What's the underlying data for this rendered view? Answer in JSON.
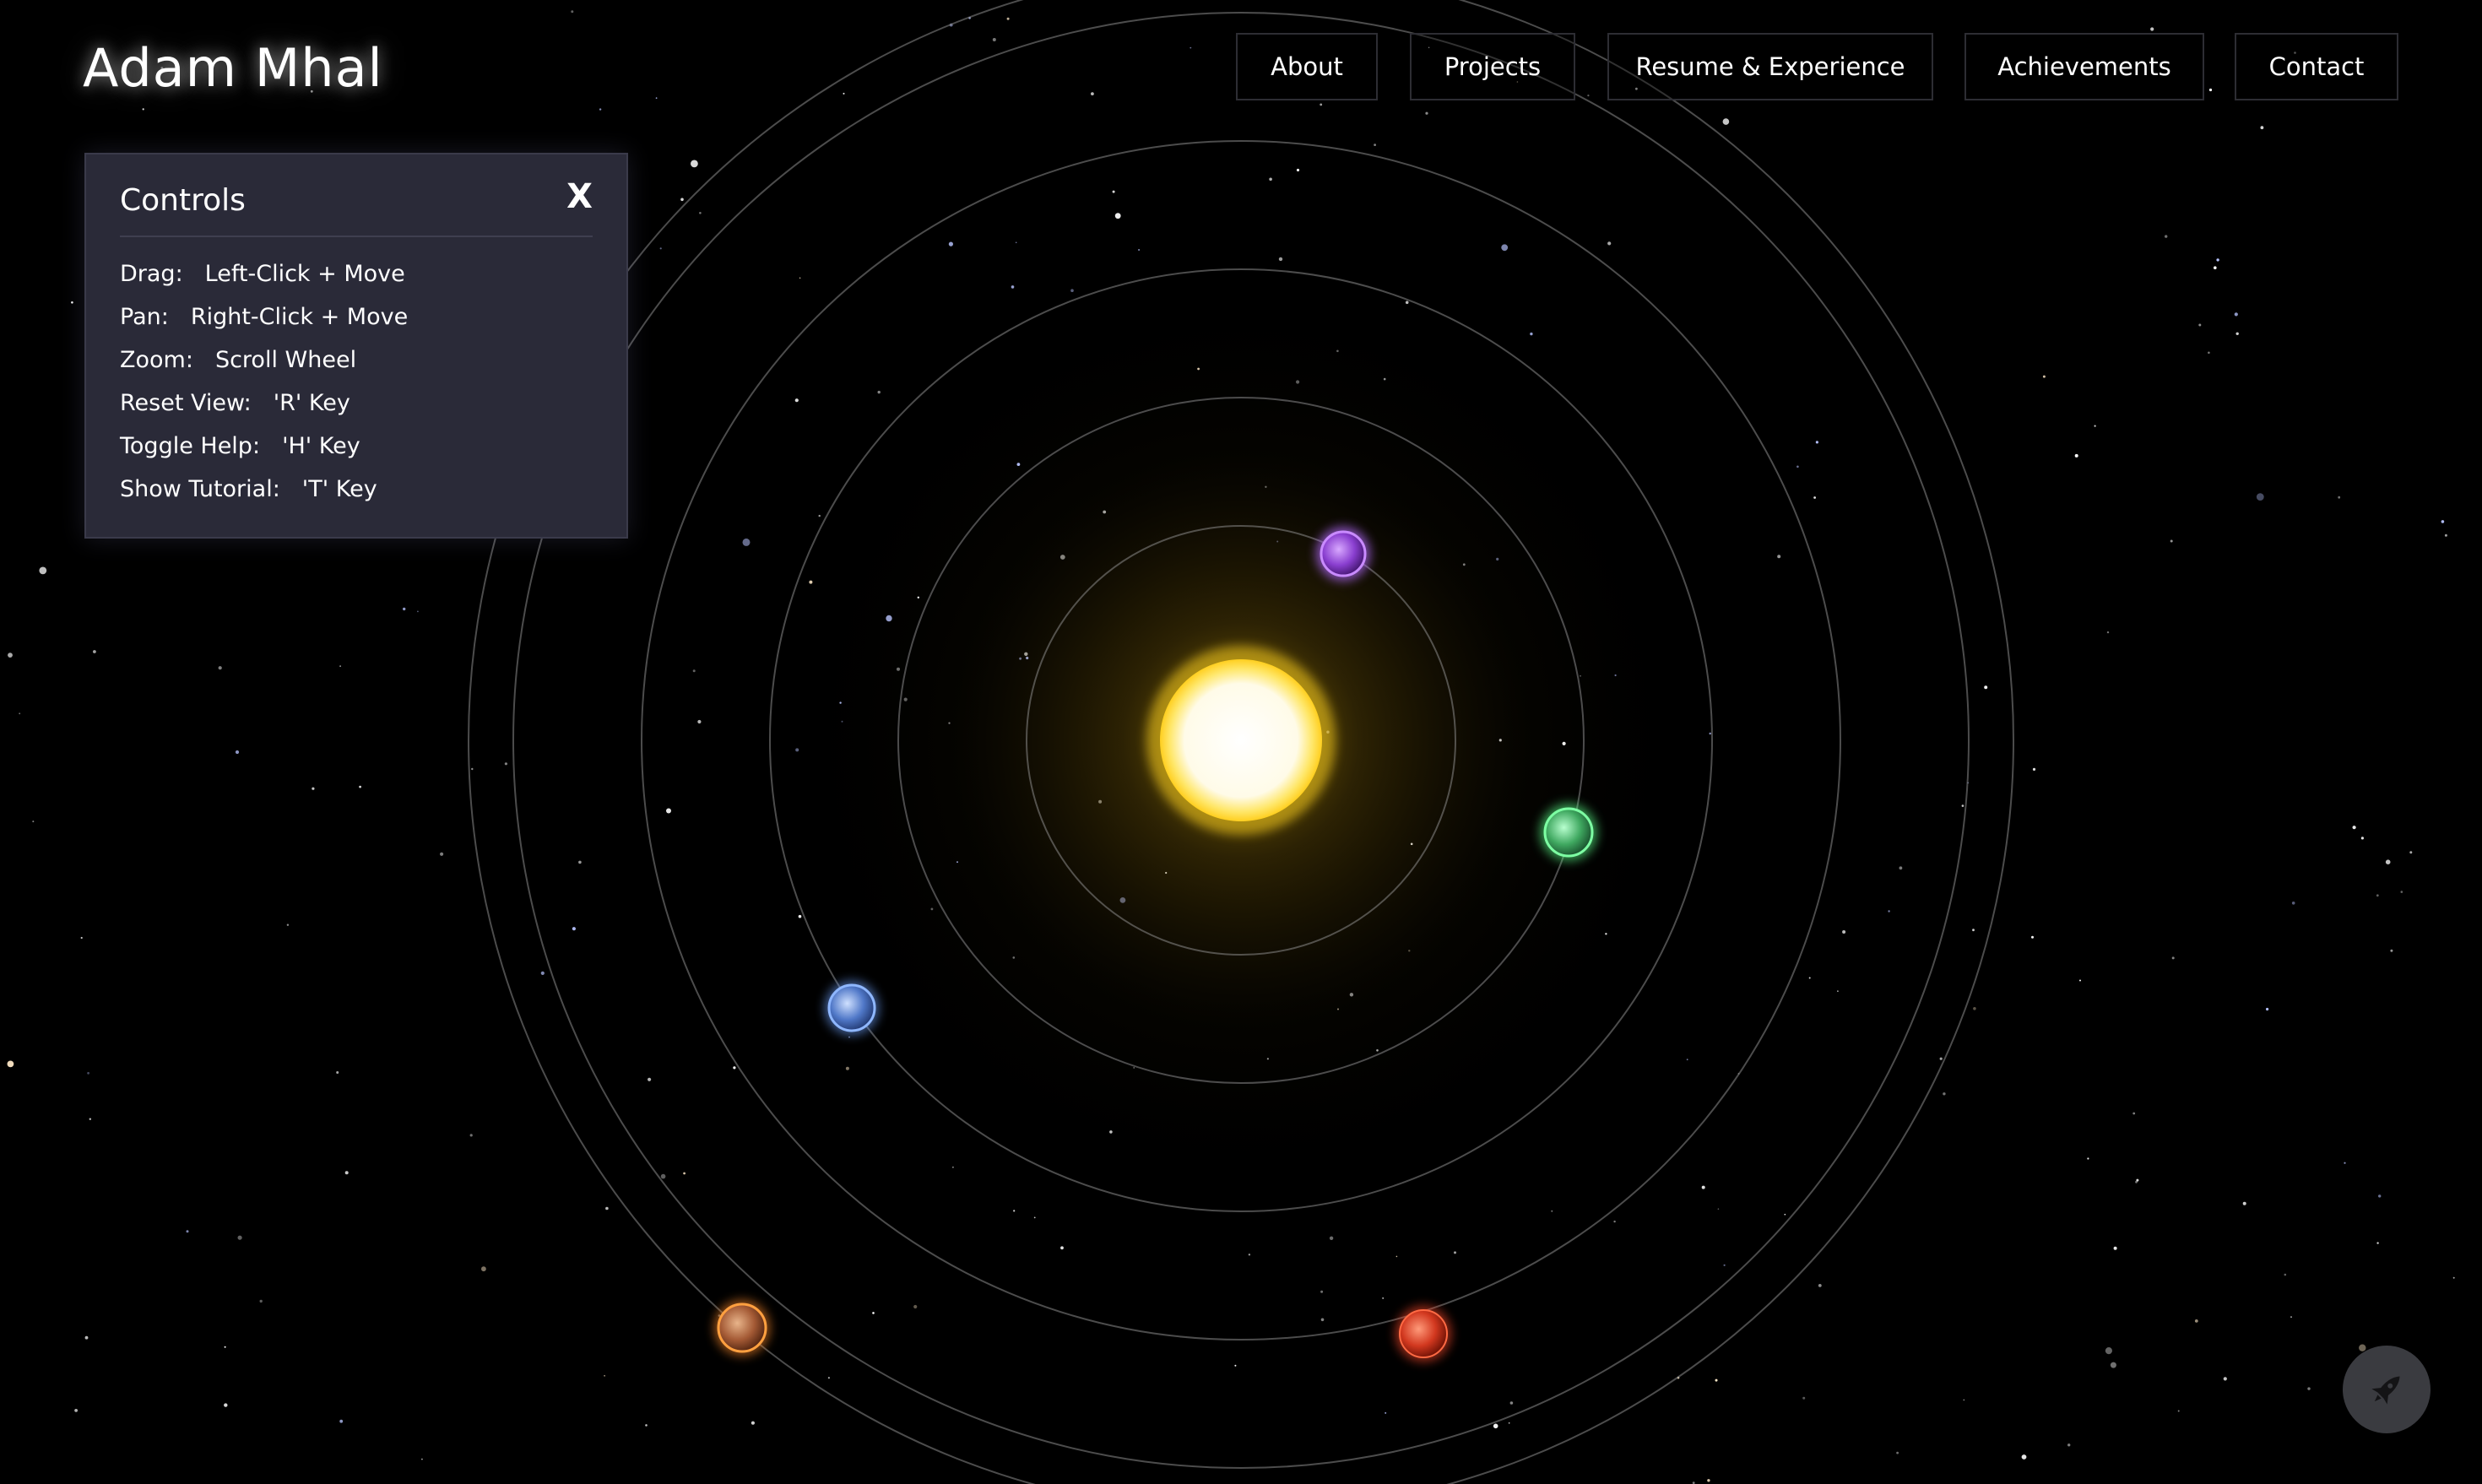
{
  "header": {
    "site_title": "Adam Mhal"
  },
  "nav": {
    "items": [
      {
        "label": "About"
      },
      {
        "label": "Projects"
      },
      {
        "label": "Resume & Experience"
      },
      {
        "label": "Achievements"
      },
      {
        "label": "Contact"
      }
    ]
  },
  "controls_panel": {
    "title": "Controls",
    "close_label": "X",
    "rows": [
      {
        "key": "Drag:",
        "value": "Left-Click + Move"
      },
      {
        "key": "Pan:",
        "value": "Right-Click + Move"
      },
      {
        "key": "Zoom:",
        "value": "Scroll Wheel"
      },
      {
        "key": "Reset View:",
        "value": "'R' Key"
      },
      {
        "key": "Toggle Help:",
        "value": "'H' Key"
      },
      {
        "key": "Show Tutorial:",
        "value": "'T' Key"
      }
    ]
  },
  "scene": {
    "sun": {
      "color": "#fff6c8",
      "glow": "#ffd21f"
    },
    "orbit_count": 6,
    "planets": [
      {
        "name": "purple-planet",
        "color": "#9b4ddb",
        "glow": "#b36bff"
      },
      {
        "name": "green-planet",
        "color": "#3fb56b",
        "glow": "#5cff8a"
      },
      {
        "name": "blue-planet",
        "color": "#5b86d6",
        "glow": "#6fa3ff"
      },
      {
        "name": "orange-planet",
        "color": "#b5653a",
        "glow": "#ff8a2a"
      },
      {
        "name": "red-planet",
        "color": "#d6402a",
        "glow": "#ff4a2a"
      }
    ]
  },
  "rocket_button": {
    "icon": "rocket-icon",
    "color": "#3a3b40"
  }
}
